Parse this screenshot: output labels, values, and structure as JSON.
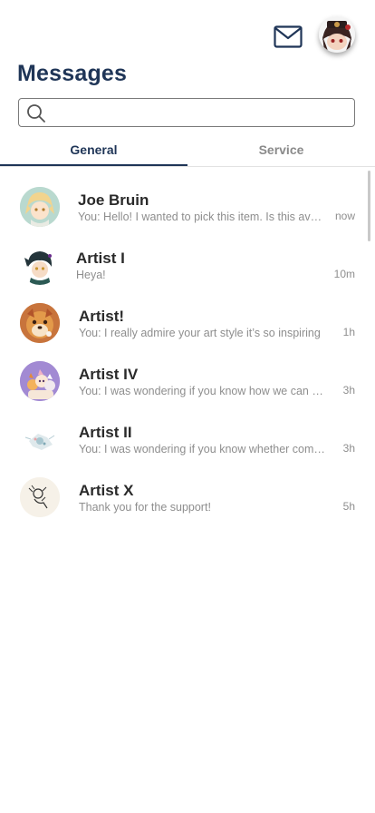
{
  "header": {
    "title": "Messages",
    "mail_icon": "envelope-icon",
    "profile_avatar": "profile-avatar"
  },
  "search": {
    "placeholder": "",
    "value": "",
    "icon": "search-icon"
  },
  "tabs": [
    {
      "label": "General",
      "active": true
    },
    {
      "label": "Service",
      "active": false
    }
  ],
  "conversations": [
    {
      "name": "Joe Bruin",
      "preview": "You: Hello! I wanted to pick this item. Is this available?",
      "time": "now",
      "avatar_bg": "#b9d9cf"
    },
    {
      "name": "Artist I",
      "preview": "Heya!",
      "time": "10m",
      "avatar_bg": "#ffffff"
    },
    {
      "name": "Artist!",
      "preview": "You: I really admire your art style it’s so inspiring",
      "time": "1h",
      "avatar_bg": "#c8743c"
    },
    {
      "name": "Artist IV",
      "preview": "You: I was wondering if you know how we can collaborate",
      "time": "3h",
      "avatar_bg": "#a28ad3"
    },
    {
      "name": "Artist II",
      "preview": "You: I was wondering if you know whether commissions are open",
      "time": "3h",
      "avatar_bg": "#ffffff"
    },
    {
      "name": "Artist X",
      "preview": "Thank you for the support!",
      "time": "5h",
      "avatar_bg": "#f6f1e8"
    }
  ],
  "colors": {
    "accent": "#1f3557",
    "muted_text": "#8e8e8e"
  }
}
